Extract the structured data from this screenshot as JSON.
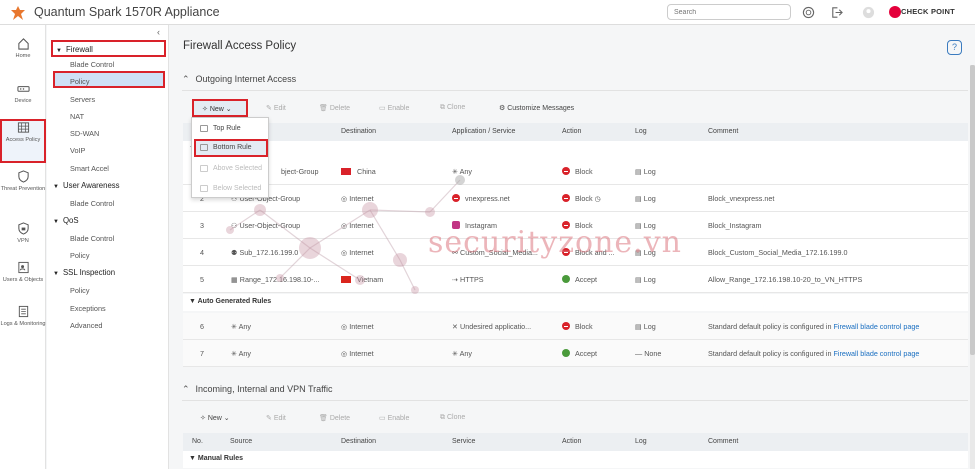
{
  "app": {
    "title": "Quantum Spark 1570R Appliance",
    "search_placeholder": "Search",
    "brand": "CHECK POINT"
  },
  "leftnav": [
    {
      "label": "Home",
      "icon": "home-icon"
    },
    {
      "label": "Device",
      "icon": "device-icon"
    },
    {
      "label": "Access Policy",
      "icon": "access-policy-icon"
    },
    {
      "label": "Threat Prevention",
      "icon": "threat-prevention-icon"
    },
    {
      "label": "VPN",
      "icon": "vpn-icon"
    },
    {
      "label": "Users & Objects",
      "icon": "users-objects-icon"
    },
    {
      "label": "Logs & Monitoring",
      "icon": "logs-monitoring-icon"
    }
  ],
  "subnav": {
    "firewall": {
      "title": "Firewall",
      "items": [
        "Blade Control",
        "Policy",
        "Servers",
        "NAT",
        "SD-WAN",
        "VoIP",
        "Smart Accel"
      ]
    },
    "user_awareness": {
      "title": "User Awareness",
      "items": [
        "Blade Control"
      ]
    },
    "qos": {
      "title": "QoS",
      "items": [
        "Blade Control",
        "Policy"
      ]
    },
    "ssl": {
      "title": "SSL Inspection",
      "items": [
        "Policy",
        "Exceptions",
        "Advanced"
      ]
    }
  },
  "page": {
    "title": "Firewall Access Policy"
  },
  "outgoing": {
    "title": "Outgoing Internet Access",
    "toolbar": {
      "new": "New",
      "edit": "Edit",
      "delete": "Delete",
      "enable": "Enable",
      "clone": "Clone",
      "customize": "Customize Messages"
    },
    "columns": [
      "Destination",
      "Application / Service",
      "Action",
      "Log",
      "Comment"
    ],
    "new_menu": [
      "Top Rule",
      "Bottom Rule",
      "Above Selected",
      "Below Selected"
    ],
    "rows": [
      {
        "no": "",
        "source": "bject-Group",
        "dest": "China",
        "service": "Any",
        "action": "Block",
        "log": "Log",
        "comment": ""
      },
      {
        "no": "2",
        "source": "User-Object-Group",
        "dest": "Internet",
        "service": "vnexpress.net",
        "action": "Block",
        "log": "Log",
        "comment": "Block_vnexpress.net"
      },
      {
        "no": "3",
        "source": "User-Object-Group",
        "dest": "Internet",
        "service": "Instagram",
        "action": "Block",
        "log": "Log",
        "comment": "Block_Instagram"
      },
      {
        "no": "4",
        "source": "Sub_172.16.199.0",
        "dest": "Internet",
        "service": "Custom_Social_Media...",
        "action": "Block and ...",
        "log": "Log",
        "comment": "Block_Custom_Social_Media_172.16.199.0"
      },
      {
        "no": "5",
        "source": "Range_172.16.198.10-...",
        "dest": "Vietnam",
        "service": "HTTPS",
        "action": "Accept",
        "log": "Log",
        "comment": "Allow_Range_172.16.198.10-20_to_VN_HTTPS"
      }
    ],
    "auto_group": "Auto Generated Rules",
    "auto_rows": [
      {
        "no": "6",
        "source": "Any",
        "dest": "Internet",
        "service": "Undesired applicatio...",
        "action": "Block",
        "log": "Log",
        "comment": "Standard default policy is configured in ",
        "link": "Firewall blade control page"
      },
      {
        "no": "7",
        "source": "Any",
        "dest": "Internet",
        "service": "Any",
        "action": "Accept",
        "log": "None",
        "comment": "Standard default policy is configured in ",
        "link": "Firewall blade control page"
      }
    ]
  },
  "incoming": {
    "title": "Incoming, Internal and VPN Traffic",
    "toolbar": {
      "new": "New",
      "edit": "Edit",
      "delete": "Delete",
      "enable": "Enable",
      "clone": "Clone"
    },
    "columns": [
      "No.",
      "Source",
      "Destination",
      "Service",
      "Action",
      "Log",
      "Comment"
    ],
    "group": "Manual Rules"
  },
  "watermark": "securityzone.vn",
  "colors": {
    "accent_red": "#d9222a",
    "block": "#d9222a",
    "accept": "#4a9a3b",
    "link": "#1a6fc1"
  }
}
